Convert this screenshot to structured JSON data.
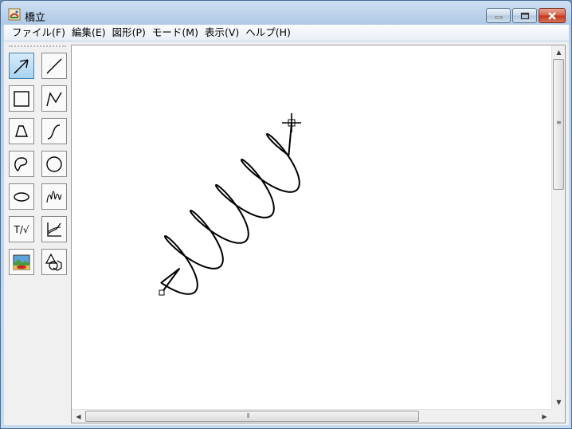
{
  "window": {
    "title": "橋立",
    "min_glyph": "–",
    "max_glyph": "▭",
    "close_glyph": "✕"
  },
  "menu": [
    {
      "label": "ファイル(F)"
    },
    {
      "label": "編集(E)"
    },
    {
      "label": "図形(P)"
    },
    {
      "label": "モード(M)"
    },
    {
      "label": "表示(V)"
    },
    {
      "label": "ヘルプ(H)"
    }
  ],
  "tools": [
    {
      "name": "select-tool",
      "icon": "arrow-select-icon",
      "active": true
    },
    {
      "name": "line-tool",
      "icon": "line-icon",
      "active": false
    },
    {
      "name": "rectangle-tool",
      "icon": "square-icon",
      "active": false
    },
    {
      "name": "polyline-tool",
      "icon": "polyline-icon",
      "active": false
    },
    {
      "name": "polygon-tool",
      "icon": "triangle-icon",
      "active": false
    },
    {
      "name": "curve-tool",
      "icon": "s-curve-icon",
      "active": false
    },
    {
      "name": "closed-curve-tool",
      "icon": "closed-curve-icon",
      "active": false
    },
    {
      "name": "circle-tool",
      "icon": "circle-icon",
      "active": false
    },
    {
      "name": "ellipse-tool",
      "icon": "ellipse-icon",
      "active": false
    },
    {
      "name": "spiral-tool",
      "icon": "spring-icon",
      "active": false
    },
    {
      "name": "text-formula-tool",
      "icon": "text-formula-icon",
      "label": "T/√",
      "active": false
    },
    {
      "name": "graph-tool",
      "icon": "graph-icon",
      "active": false
    },
    {
      "name": "image-tool",
      "icon": "picture-icon",
      "active": false
    },
    {
      "name": "shapes-tool",
      "icon": "shapes-icon",
      "active": false
    }
  ],
  "canvas": {
    "drawing": "spring-coil",
    "cursor": "crosshair-move-icon"
  },
  "colors": {
    "active_tool": "#a9d3f2",
    "close_button": "#c23518",
    "stroke": "#000000"
  }
}
